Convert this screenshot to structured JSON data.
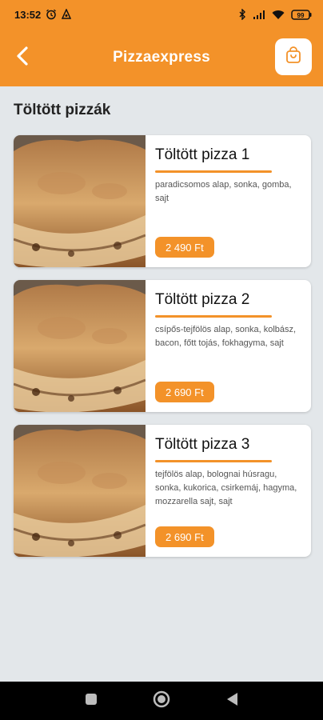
{
  "status": {
    "time": "13:52",
    "battery": "99",
    "icons": [
      "alarm-icon",
      "android-icon",
      "bluetooth-icon",
      "signal-icon",
      "wifi-icon",
      "battery-icon"
    ]
  },
  "header": {
    "title": "Pizzaexpress",
    "back_icon": "chevron-left-icon",
    "cart_icon": "shopping-bag-icon"
  },
  "section": {
    "title": "Töltött pizzák"
  },
  "products": [
    {
      "name": "Töltött pizza 1",
      "description": "paradicsomos alap, sonka, gomba, sajt",
      "price": "2 490 Ft"
    },
    {
      "name": "Töltött pizza 2",
      "description": "csípős-tejfölös alap, sonka, kolbász, bacon, főtt tojás, fokhagyma, sajt",
      "price": "2 690 Ft"
    },
    {
      "name": "Töltött pizza 3",
      "description": "tejfölös alap, bolognai húsragu, sonka, kukorica, csirkemáj, hagyma, mozzarella sajt, sajt",
      "price": "2 690 Ft"
    }
  ],
  "nav": {
    "icons": [
      "recents-icon",
      "home-icon",
      "back-icon"
    ]
  },
  "colors": {
    "accent": "#f39229",
    "background": "#e3e7ea"
  }
}
